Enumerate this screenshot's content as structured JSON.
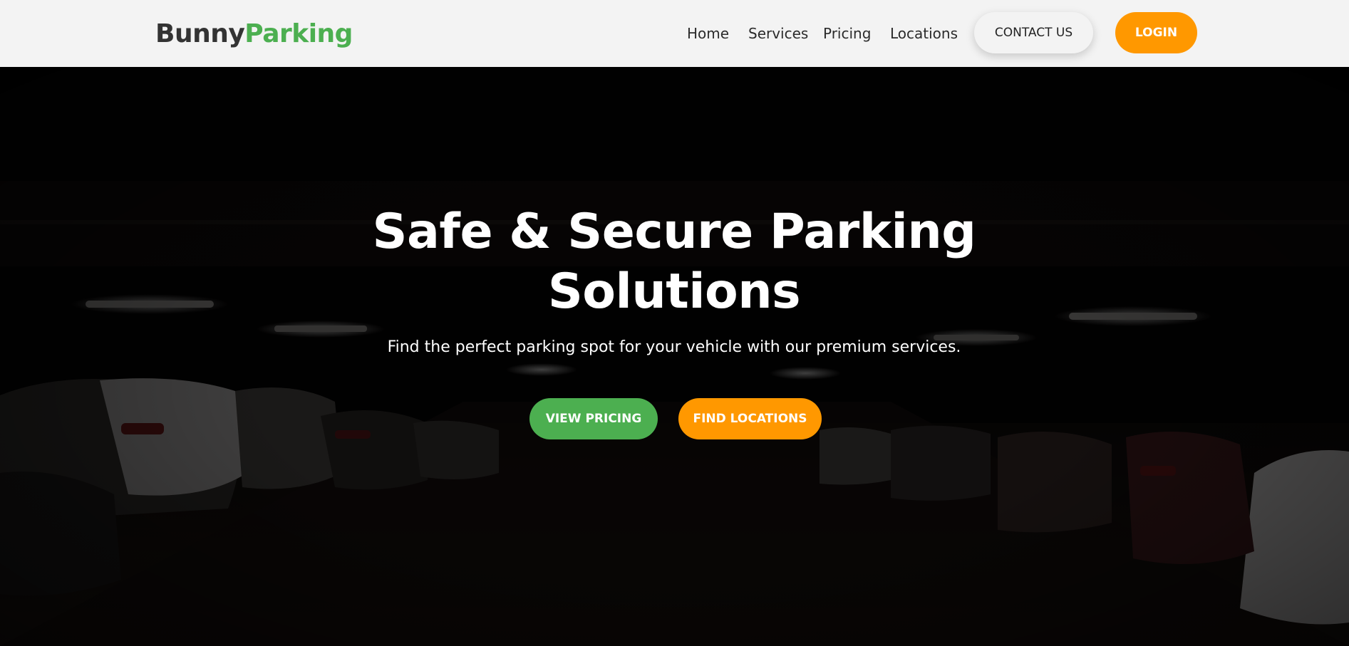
{
  "header": {
    "logo_part1": "Bunny",
    "logo_part2": "Parking",
    "nav": [
      {
        "label": "Home"
      },
      {
        "label": "Services"
      },
      {
        "label": "Pricing"
      },
      {
        "label": "Locations"
      }
    ],
    "contact_label": "CONTACT US",
    "login_label": "LOGIN"
  },
  "hero": {
    "title": "Safe & Secure Parking Solutions",
    "subtitle": "Find the perfect parking spot for your vehicle with our premium services.",
    "primary_button": "VIEW PRICING",
    "secondary_button": "FIND LOCATIONS",
    "background_image": "dark parking garage with parked cars"
  },
  "colors": {
    "brand_green": "#4caf50",
    "brand_orange": "#ff9800",
    "header_bg": "#f3f3f3",
    "logo_dark": "#333333",
    "hero_overlay": "#000000"
  }
}
